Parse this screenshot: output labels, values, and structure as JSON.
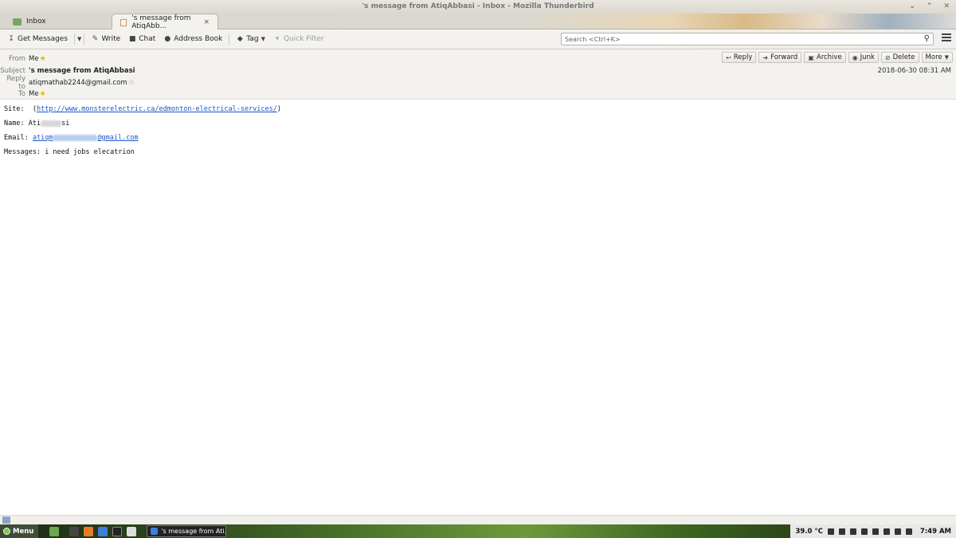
{
  "window": {
    "title": "'s message from AtiqAbbasi - Inbox - Mozilla Thunderbird",
    "controls": [
      "minimize",
      "maximize",
      "close"
    ]
  },
  "tabs": [
    {
      "label": "Inbox",
      "icon": "inbox-icon"
    },
    {
      "label": "'s message from AtiqAbb...",
      "icon": "envelope-icon",
      "close": "×"
    }
  ],
  "toolbar": {
    "get_messages": "Get Messages",
    "write": "Write",
    "chat": "Chat",
    "address_book": "Address Book",
    "tag": "Tag",
    "quick_filter": "Quick Filter",
    "search_placeholder": "Search <Ctrl+K>"
  },
  "header": {
    "from_label": "From",
    "from_value": "Me",
    "subject_label": "Subject",
    "subject_value": "'s message from AtiqAbbasi",
    "replyto_label": "Reply to",
    "replyto_value": "atiqmathab2244@gmail.com",
    "to_label": "To",
    "to_value": "Me",
    "date": "2018-06-30 08:31 AM",
    "actions": {
      "reply": "Reply",
      "forward": "Forward",
      "archive": "Archive",
      "junk": "Junk",
      "delete": "Delete",
      "more": "More"
    }
  },
  "body": {
    "site_label": "Site:",
    "site_open": "(",
    "site_url": "http://www.monsterelectric.ca/edmonton-electrical-services/",
    "site_close": ")",
    "name_label": "Name:",
    "name_start": "Ati",
    "name_end": "si",
    "email_label": "Email:",
    "email_start": "atiqm",
    "email_end": "@gmail.com",
    "messages_label": "Messages:",
    "messages_value": "i need jobs elecatrion"
  },
  "taskbar": {
    "menu_label": "Menu",
    "task_label": "'s message from Ati...",
    "temperature": "39.0 °C",
    "clock": "7:49 AM"
  }
}
